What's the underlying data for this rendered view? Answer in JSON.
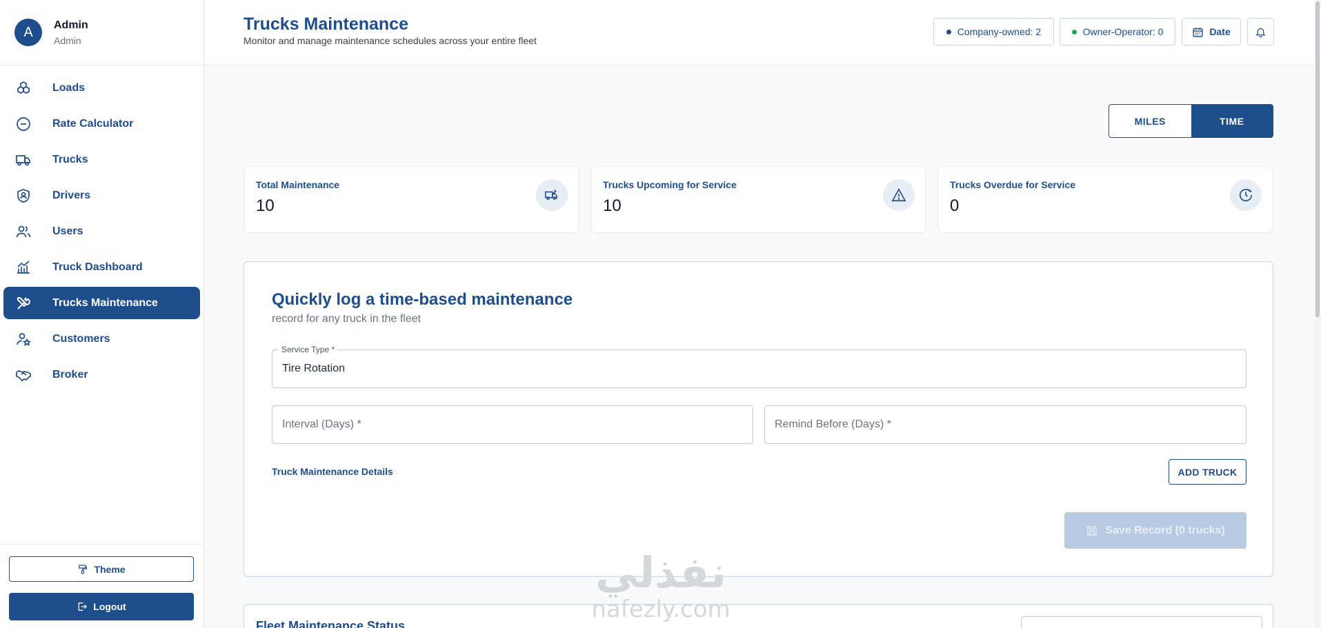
{
  "user": {
    "initial": "A",
    "name": "Admin",
    "role": "Admin"
  },
  "sidebar": {
    "items": [
      {
        "label": "Loads",
        "icon": "cubes-icon"
      },
      {
        "label": "Rate Calculator",
        "icon": "minus-circle-icon"
      },
      {
        "label": "Trucks",
        "icon": "truck-icon"
      },
      {
        "label": "Drivers",
        "icon": "shield-user-icon"
      },
      {
        "label": "Users",
        "icon": "users-icon"
      },
      {
        "label": "Truck Dashboard",
        "icon": "chart-icon"
      },
      {
        "label": "Trucks Maintenance",
        "icon": "tools-icon",
        "active": true
      },
      {
        "label": "Customers",
        "icon": "user-star-icon"
      },
      {
        "label": "Broker",
        "icon": "handshake-icon"
      }
    ],
    "theme_label": "Theme",
    "logout_label": "Logout"
  },
  "header": {
    "title": "Trucks Maintenance",
    "subtitle": "Monitor and manage maintenance schedules across your entire fleet",
    "company_owned": "Company-owned: 2",
    "owner_operator": "Owner-Operator: 0",
    "date_label": "Date"
  },
  "colors": {
    "primary": "#1e4d8c",
    "company_dot": "#1e4d8c",
    "owner_dot": "#22a447"
  },
  "toggle": {
    "miles": "MILES",
    "time": "TIME",
    "selected": "TIME"
  },
  "stats": [
    {
      "label": "Total Maintenance",
      "value": "10",
      "icon": "truck-wrench-icon"
    },
    {
      "label": "Trucks Upcoming for Service",
      "value": "10",
      "icon": "warning-icon"
    },
    {
      "label": "Trucks Overdue for Service",
      "value": "0",
      "icon": "clock-icon"
    }
  ],
  "form": {
    "title": "Quickly log a time-based maintenance",
    "subtitle": "record for any truck in the fleet",
    "service_type_label": "Service Type *",
    "service_type_value": "Tire Rotation",
    "interval_placeholder": "Interval (Days) *",
    "remind_placeholder": "Remind Before (Days) *",
    "details_link": "Truck Maintenance Details",
    "add_truck": "ADD TRUCK",
    "save": "Save Record (0 trucks)"
  },
  "fleet": {
    "title": "Fleet Maintenance Status"
  },
  "watermark": {
    "arabic": "نفذلي",
    "latin": "nafezly.com"
  }
}
